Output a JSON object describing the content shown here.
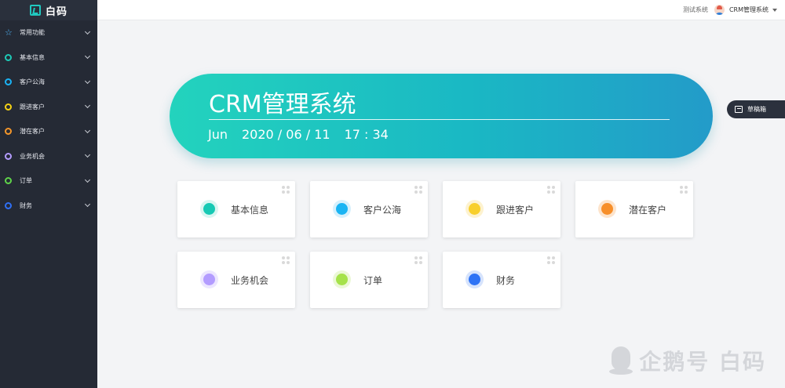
{
  "app": {
    "logo_text": "白码"
  },
  "sidebar": {
    "items": [
      {
        "label": "常用功能",
        "icon": "star-icon",
        "color": "#4fb9ff"
      },
      {
        "label": "基本信息",
        "icon": "circle-icon",
        "color": "#1ec9b6"
      },
      {
        "label": "客户公海",
        "icon": "circle-icon",
        "color": "#1ab3f5"
      },
      {
        "label": "跟进客户",
        "icon": "circle-icon",
        "color": "#f5d214"
      },
      {
        "label": "潜在客户",
        "icon": "circle-icon",
        "color": "#f5962a"
      },
      {
        "label": "业务机会",
        "icon": "circle-icon",
        "color": "#b49cff"
      },
      {
        "label": "订单",
        "icon": "circle-icon",
        "color": "#5fd34a"
      },
      {
        "label": "财务",
        "icon": "circle-icon",
        "color": "#2f6ff5"
      }
    ]
  },
  "header": {
    "test_system": "测试系统",
    "user_name": "CRM管理系统"
  },
  "hero": {
    "title": "CRM管理系统",
    "month": "Jun",
    "date": "2020 / 06 / 11",
    "time": "17 : 34"
  },
  "draft_tab": {
    "label": "草稿箱"
  },
  "cards": [
    {
      "label": "基本信息",
      "color": "#17c9b4",
      "halo": "#d8f6f1"
    },
    {
      "label": "客户公海",
      "color": "#1ab4f3",
      "halo": "#d6f0fc"
    },
    {
      "label": "跟进客户",
      "color": "#f8cf2b",
      "halo": "#fdf2cf"
    },
    {
      "label": "潜在客户",
      "color": "#f78f2a",
      "halo": "#fde4cc"
    },
    {
      "label": "业务机会",
      "color": "#b39cff",
      "halo": "#ece6ff"
    },
    {
      "label": "订单",
      "color": "#a5e24a",
      "halo": "#ebf8d6"
    },
    {
      "label": "财务",
      "color": "#2e73f5",
      "halo": "#d6e3fc"
    }
  ],
  "watermark": {
    "text": "企鹅号 白码"
  }
}
